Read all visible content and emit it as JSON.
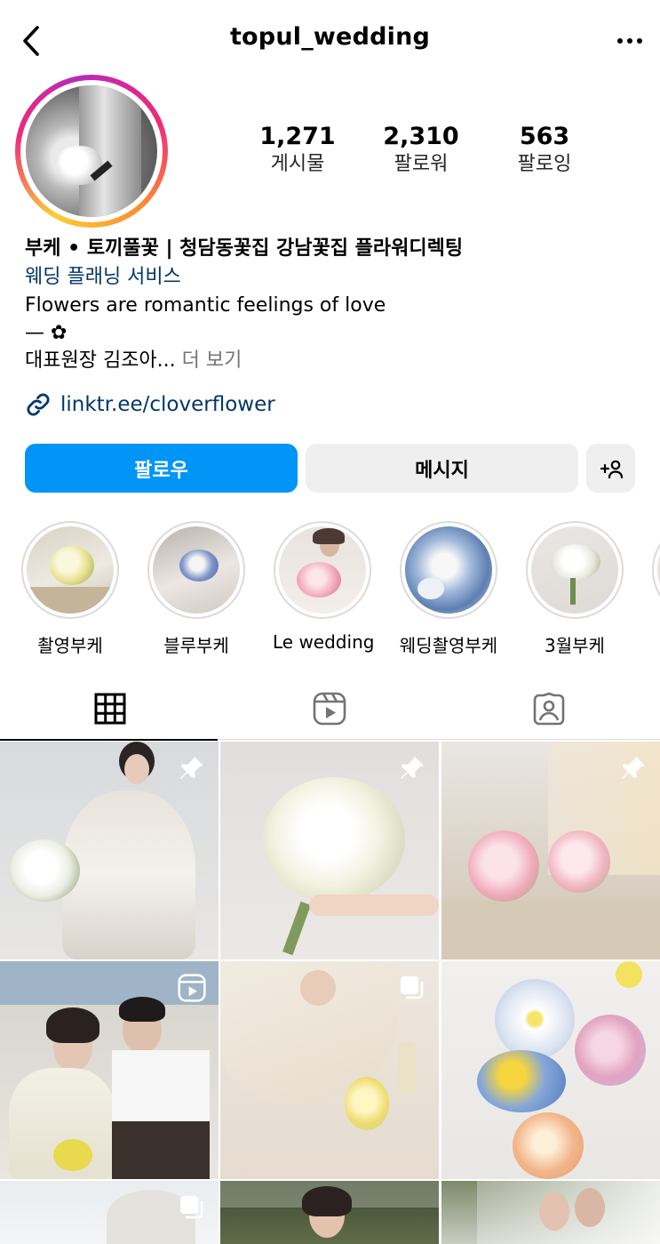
{
  "header": {
    "username": "topul_wedding",
    "back_icon": "chevron-left-icon",
    "more_icon": "more-horizontal-icon"
  },
  "stats": [
    {
      "value": "1,271",
      "label": "게시물"
    },
    {
      "value": "2,310",
      "label": "팔로워"
    },
    {
      "value": "563",
      "label": "팔로잉"
    }
  ],
  "bio": {
    "name": "부케 • 토끼풀꽃  | 청담동꽃집 강남꽃집 플라워디렉팅",
    "category": "웨딩 플래닝 서비스",
    "line1": "Flowers are romantic feelings of love",
    "line2": "— ✿",
    "line3": "대표원장 김조아...",
    "more": " 더 보기",
    "link": "linktr.ee/cloverflower"
  },
  "buttons": {
    "follow": "팔로우",
    "message": "메시지",
    "add_user_icon": "add-user-icon"
  },
  "highlights": [
    {
      "label": "촬영부케"
    },
    {
      "label": "블루부케"
    },
    {
      "label": "Le wedding"
    },
    {
      "label": "웨딩촬영부케"
    },
    {
      "label": "3월부케"
    }
  ],
  "tabs": [
    {
      "icon": "grid-icon",
      "active": true
    },
    {
      "icon": "reels-icon",
      "active": false
    },
    {
      "icon": "tagged-icon",
      "active": false
    }
  ],
  "posts": [
    {
      "badge": "pin-icon"
    },
    {
      "badge": "pin-icon"
    },
    {
      "badge": "pin-icon"
    },
    {
      "badge": "reels-icon"
    },
    {
      "badge": "carousel-icon"
    },
    {
      "badge": ""
    },
    {
      "badge": "carousel-icon"
    },
    {
      "badge": ""
    },
    {
      "badge": ""
    }
  ],
  "colors": {
    "primary": "#0095f6",
    "link": "#00376b",
    "secondary_button": "#efefef",
    "muted": "#737373"
  }
}
